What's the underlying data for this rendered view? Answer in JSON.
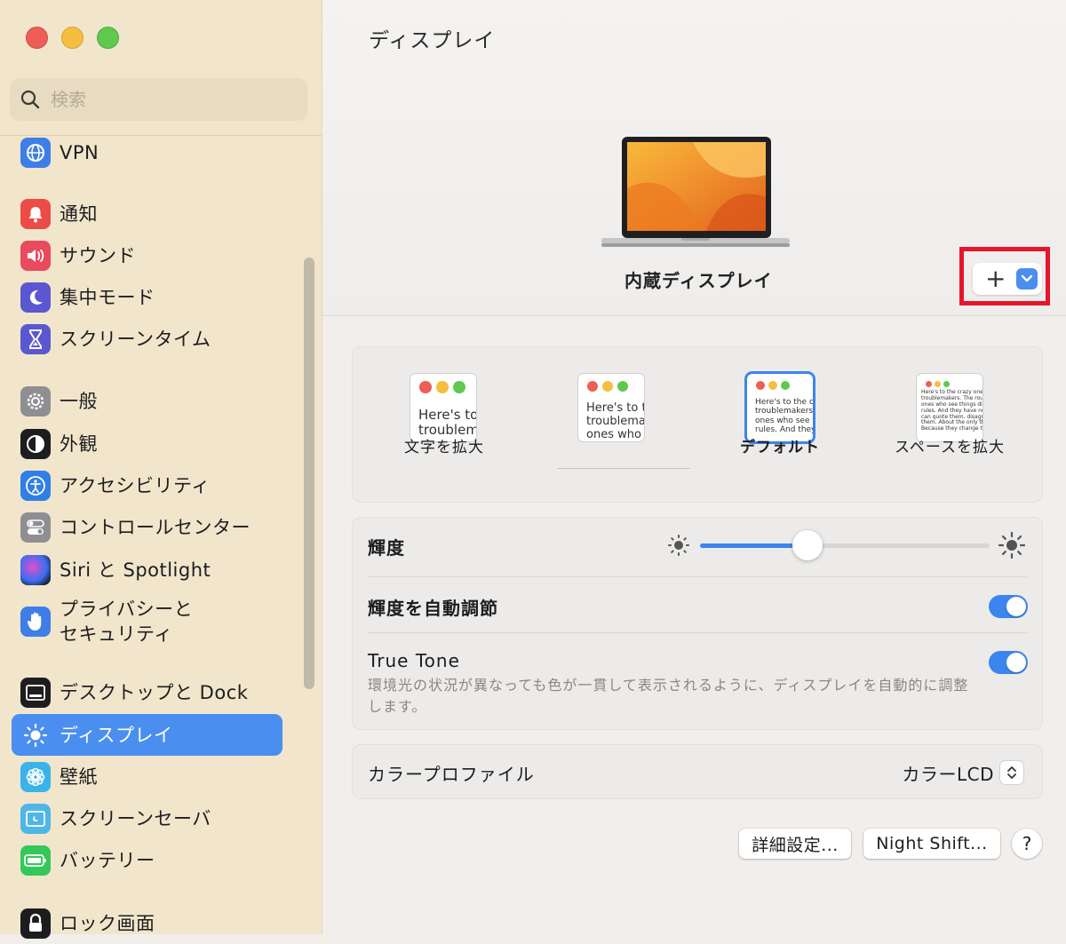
{
  "window": {
    "title": "ディスプレイ"
  },
  "search": {
    "placeholder": "検索"
  },
  "sidebar": {
    "items": [
      {
        "label": "VPN"
      },
      {
        "label": "通知"
      },
      {
        "label": "サウンド"
      },
      {
        "label": "集中モード"
      },
      {
        "label": "スクリーンタイム"
      },
      {
        "label": "一般"
      },
      {
        "label": "外観"
      },
      {
        "label": "アクセシビリティ"
      },
      {
        "label": "コントロールセンター"
      },
      {
        "label": "Siri と Spotlight"
      },
      {
        "label": "プライバシーと\nセキュリティ"
      },
      {
        "label": "デスクトップと Dock"
      },
      {
        "label": "ディスプレイ"
      },
      {
        "label": "壁紙"
      },
      {
        "label": "スクリーンセーバ"
      },
      {
        "label": "バッテリー"
      },
      {
        "label": "ロック画面"
      }
    ],
    "selected": "ディスプレイ"
  },
  "display": {
    "name": "内蔵ディスプレイ",
    "add_button_label": "+"
  },
  "resolution": {
    "options": [
      {
        "label": "文字を拡大",
        "sample": "Here's to\ntroublem"
      },
      {
        "label": "",
        "sample": "Here's to t\ntroublema\nones who"
      },
      {
        "label": "デフォルト",
        "sample": "Here's to the cr\ntroublemakers.\nones who see t\nrules. And they"
      },
      {
        "label": "スペースを拡大",
        "sample": "Here's to the crazy one\ntroublemakers. The rou\nones who see things dif\nrules. And they have no\ncan quote them, disagr\nthem. About the only th\nBecause they change t"
      }
    ],
    "selected": "デフォルト"
  },
  "brightness": {
    "label": "輝度",
    "value": 0.37
  },
  "auto_brightness": {
    "label": "輝度を自動調節",
    "on": true
  },
  "true_tone": {
    "label": "True Tone",
    "on": true,
    "description": "環境光の状況が異なっても色が一貫して表示されるように、ディスプレイを自動的に調整します。"
  },
  "color_profile": {
    "label": "カラープロファイル",
    "value": "カラーLCD"
  },
  "buttons": {
    "advanced": "詳細設定...",
    "night_shift": "Night Shift...",
    "help": "?"
  },
  "colors": {
    "accent": "#3b86ee",
    "sidebar_bg": "#f1e6cc",
    "highlight": "#e5152a"
  }
}
